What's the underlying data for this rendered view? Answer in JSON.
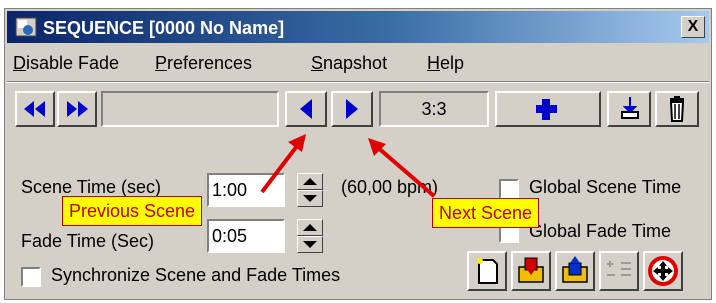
{
  "window": {
    "title": "SEQUENCE [0000 No Name]",
    "close_label": "X"
  },
  "menu": {
    "items": [
      {
        "label": "Disable Fade",
        "accel": "D"
      },
      {
        "label": "Preferences",
        "accel": "P"
      },
      {
        "label": "Snapshot",
        "accel": "S"
      },
      {
        "label": "Help",
        "accel": "H"
      }
    ]
  },
  "transport": {
    "scene_counter": "3:3"
  },
  "scene_time": {
    "label": "Scene Time (sec)",
    "value": "1:00",
    "bpm": "(60,00 bpm)"
  },
  "fade_time": {
    "label": "Fade Time (Sec)",
    "value": "0:05"
  },
  "checkboxes": {
    "global_scene_time": "Global Scene Time",
    "global_fade_time": "Global Fade Time",
    "sync_times": "Synchronize Scene and Fade Times"
  },
  "callouts": {
    "previous": "Previous Scene",
    "next": "Next Scene"
  },
  "colors": {
    "arrow_blue": "#0000cc",
    "callout_red": "#e00000",
    "callout_bg": "#ffff00",
    "titlebar": "#0a246a"
  }
}
